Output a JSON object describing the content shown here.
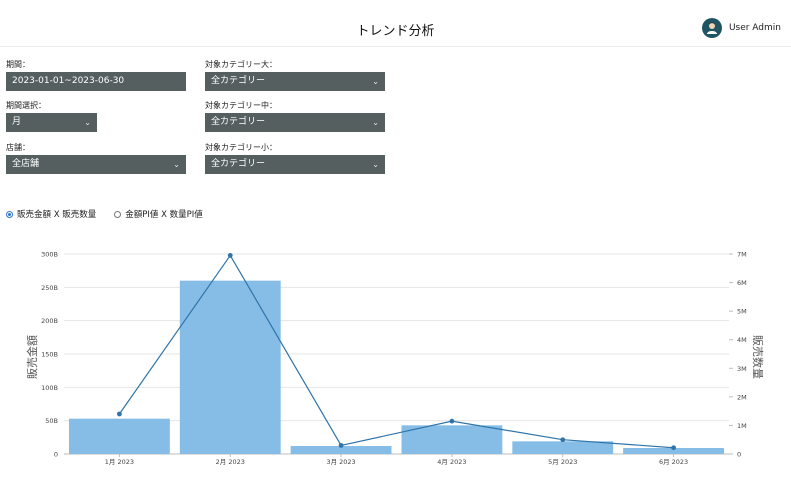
{
  "header": {
    "title": "トレンド分析",
    "user_name": "User Admin"
  },
  "filters": {
    "period": {
      "label": "期間：",
      "value": "2023-01-01~2023-06-30"
    },
    "period_type": {
      "label": "期間選択：",
      "value": "月"
    },
    "store": {
      "label": "店舗：",
      "value": "全店舗"
    },
    "category_large": {
      "label": "対象カテゴリー大：",
      "value": "全カテゴリー"
    },
    "category_medium": {
      "label": "対象カテゴリー中：",
      "value": "全カテゴリー"
    },
    "category_small": {
      "label": "対象カテゴリー小：",
      "value": "全カテゴリー"
    }
  },
  "mode": {
    "options": [
      {
        "label": "販売金額 X 販売数量",
        "checked": true
      },
      {
        "label": "金額PI値 X 数量PI値",
        "checked": false
      }
    ]
  },
  "colors": {
    "bar": "#86bde6",
    "line": "#2f74a8",
    "select_bg": "#555f5f"
  },
  "chart_data": {
    "type": "bar",
    "categories": [
      "1月 2023",
      "2月 2023",
      "3月 2023",
      "4月 2023",
      "5月 2023",
      "6月 2023"
    ],
    "series": [
      {
        "type": "bar",
        "axis": "left",
        "values": [
          53,
          260,
          12,
          43,
          19,
          9
        ]
      },
      {
        "type": "line",
        "axis": "right",
        "values": [
          1.4,
          6.95,
          0.3,
          1.15,
          0.5,
          0.22
        ]
      }
    ],
    "ylabel": "販売金額",
    "ylabel_right": "販売数量",
    "ylim": [
      0,
      300
    ],
    "ylim_right": [
      0,
      7
    ],
    "yticks": [
      "0",
      "50B",
      "100B",
      "150B",
      "200B",
      "250B",
      "300B"
    ],
    "yticks_right": [
      "0",
      "1M",
      "2M",
      "3M",
      "4M",
      "5M",
      "6M",
      "7M"
    ],
    "grid": true
  }
}
